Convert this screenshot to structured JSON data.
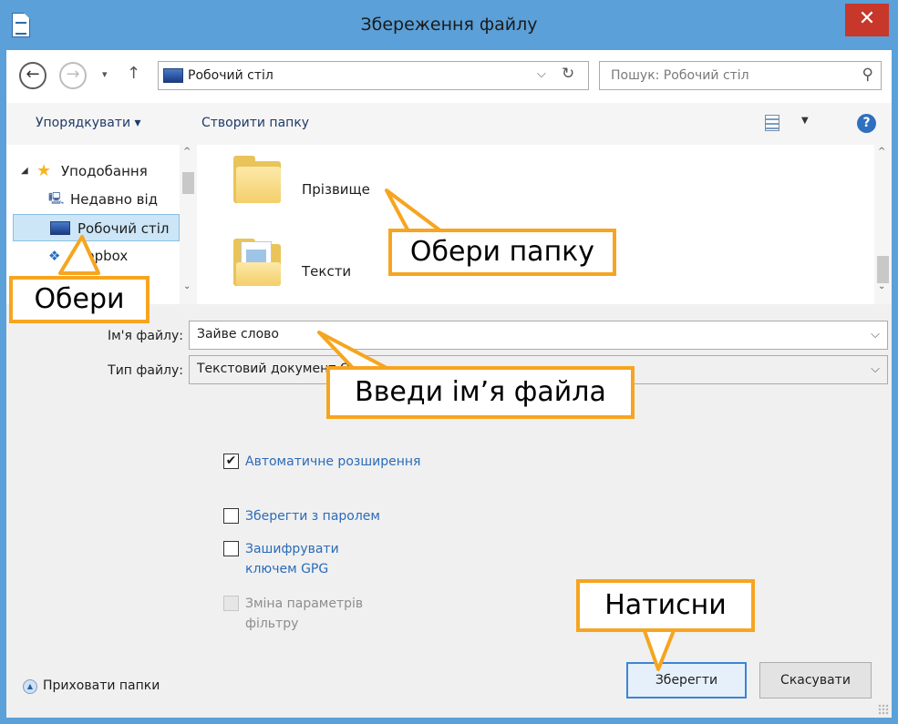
{
  "window": {
    "title": "Збереження файлу",
    "close_glyph": "✕"
  },
  "address_bar": {
    "back_glyph": "←",
    "forward_glyph": "→",
    "recent_glyph": "▾",
    "up_glyph": "↑",
    "path": "Робочий стіл",
    "dropdown_glyph": "⌵",
    "refresh_glyph": "↻",
    "search_placeholder": "Пошук: Робочий стіл",
    "search_glyph": "⚲"
  },
  "toolbar": {
    "organize_label": "Упорядкувати ▾",
    "new_folder_label": "Створити папку",
    "view_dropdown_glyph": "▼",
    "help_glyph": "?"
  },
  "nav_pane": {
    "items": [
      {
        "label": "Уподобання",
        "icon": "star-icon",
        "glyph": "★"
      },
      {
        "label": "Недавно від",
        "icon": "recent-places-icon",
        "glyph": "🖳"
      },
      {
        "label": "Робочий стіл",
        "icon": "desktop-icon",
        "glyph": ""
      },
      {
        "label": "Dropbox",
        "icon": "dropbox-icon",
        "glyph": "❖"
      }
    ],
    "expand_glyph": "◢",
    "scroll_up": "^",
    "scroll_down": "⌄"
  },
  "files": [
    {
      "name": "Прізвище",
      "icon": "folder-icon"
    },
    {
      "name": "Тексти",
      "icon": "document-folder-icon"
    }
  ],
  "form": {
    "filename_label": "Ім'я файлу:",
    "filename_value": "Зайве слово",
    "filetype_label": "Тип файлу:",
    "filetype_value": "Текстовий документ ODF",
    "dropdown_glyph": "⌵"
  },
  "options": [
    {
      "label": "Автоматичне розширення",
      "checked": true,
      "check_glyph": "✔",
      "enabled": true
    },
    {
      "label": "Зберегти з паролем",
      "checked": false,
      "check_glyph": "",
      "enabled": true
    },
    {
      "label": "Зашифрувати ключем GPG",
      "checked": false,
      "check_glyph": "",
      "enabled": true
    },
    {
      "label": "Зміна параметрів фільтру",
      "checked": false,
      "check_glyph": "",
      "enabled": false
    }
  ],
  "footer": {
    "hide_folders_label": "Приховати папки",
    "hide_folders_glyph": "▲",
    "save_label": "Зберегти",
    "cancel_label": "Скасувати"
  },
  "callouts": {
    "choose": "Обери",
    "choose_folder": "Обери папку",
    "enter_name": "Введи ім’я файла",
    "press": "Натисни"
  },
  "colors": {
    "titlebar": "#5ba0d8",
    "close_button": "#c7372a",
    "callout_border": "#f6a520",
    "link_text": "#2a6bb8",
    "selection": "#cce6f7"
  }
}
